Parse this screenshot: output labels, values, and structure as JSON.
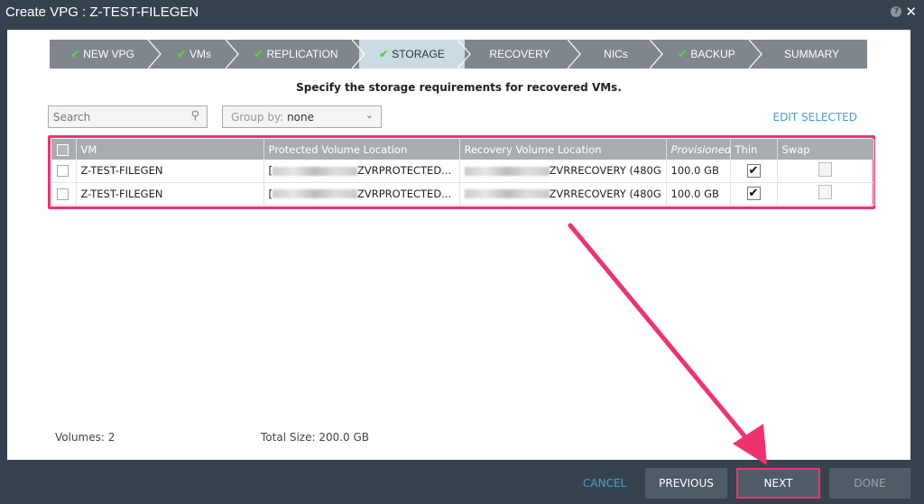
{
  "window": {
    "title": "Create VPG : Z-TEST-FILEGEN",
    "help_icon": "?",
    "close_icon": "✕"
  },
  "wizard": {
    "steps": [
      {
        "label": "NEW VPG",
        "done": true
      },
      {
        "label": "VMs",
        "done": true
      },
      {
        "label": "REPLICATION",
        "done": true
      },
      {
        "label": "STORAGE",
        "done": true,
        "active": true
      },
      {
        "label": "RECOVERY",
        "done": false
      },
      {
        "label": "NICs",
        "done": false
      },
      {
        "label": "BACKUP",
        "done": true
      },
      {
        "label": "SUMMARY",
        "done": false
      }
    ],
    "check": "✔"
  },
  "instruction": "Specify the storage requirements for recovered VMs.",
  "toolbar": {
    "search_placeholder": "Search",
    "group_by_label": "Group by:",
    "group_by_value": "none",
    "edit_selected": "EDIT SELECTED"
  },
  "table": {
    "columns": [
      "VM",
      "Protected Volume Location",
      "Recovery Volume Location",
      "Provisioned",
      "Thin",
      "Swap"
    ],
    "rows": [
      {
        "vm": "Z-TEST-FILEGEN",
        "protected": "ZVRPROTECTED...",
        "recovery": "ZVRRECOVERY (480G",
        "provisioned": "100.0 GB",
        "thin": true,
        "swap": false
      },
      {
        "vm": "Z-TEST-FILEGEN",
        "protected": "ZVRPROTECTED...",
        "recovery": "ZVRRECOVERY (480G",
        "provisioned": "100.0 GB",
        "thin": true,
        "swap": false
      }
    ]
  },
  "summary": {
    "volumes": "Volumes: 2",
    "total_size": "Total Size: 200.0 GB"
  },
  "footer": {
    "cancel": "CANCEL",
    "previous": "PREVIOUS",
    "next": "NEXT",
    "done": "DONE"
  },
  "colors": {
    "highlight": "#f0326e",
    "accent": "#4a9fc8",
    "check": "#5fd03f"
  }
}
